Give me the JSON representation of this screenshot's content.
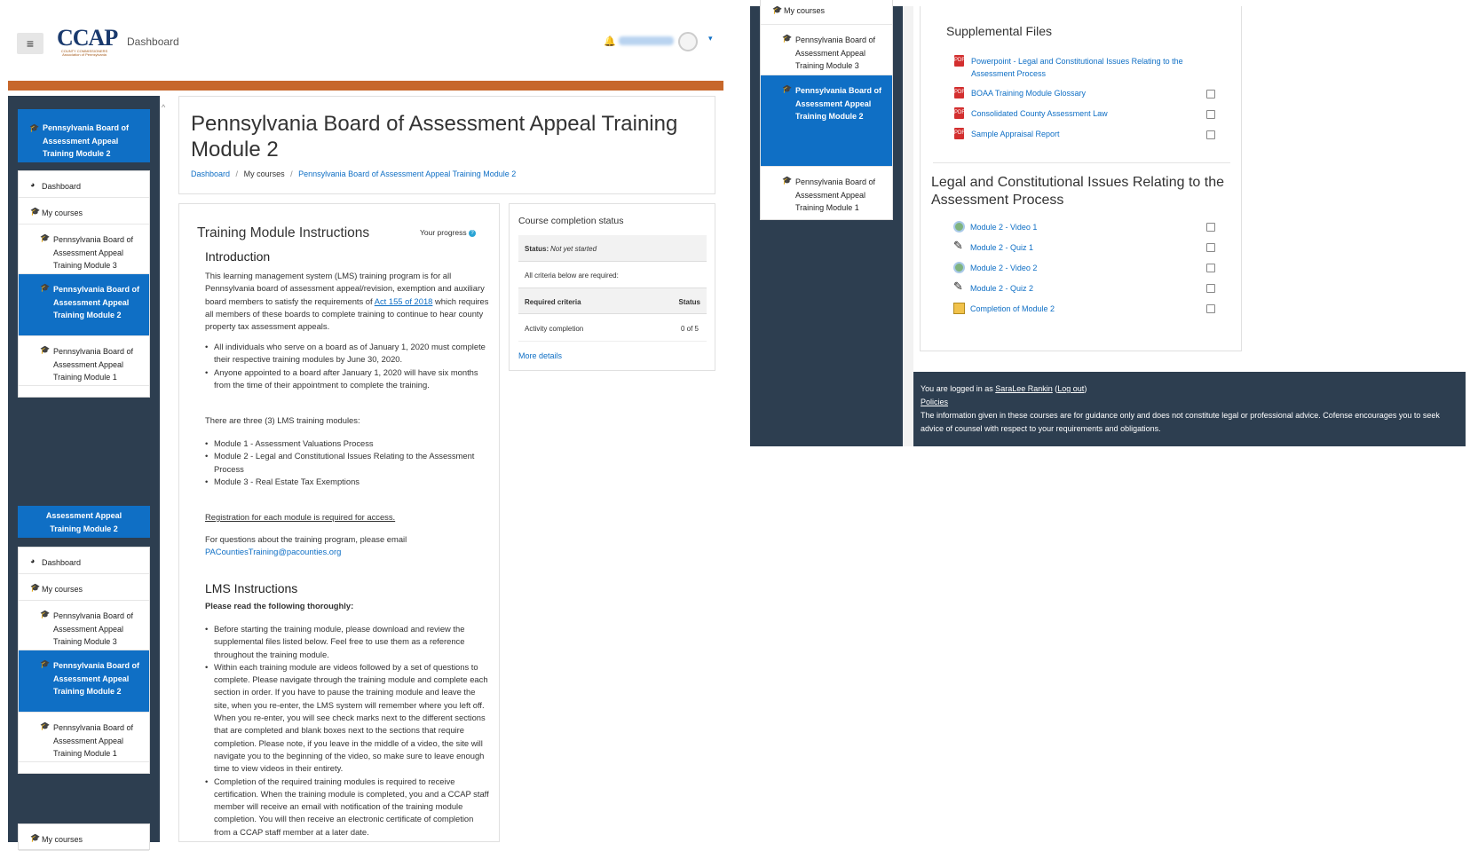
{
  "header": {
    "menu_icon": "hamburger-icon",
    "logo_text": "CCAP",
    "logo_sub": "COUNTY COMMISSIONERS Association of Pennsylvania",
    "nav_dashboard": "Dashboard",
    "bell_icon": "bell-icon",
    "caret": "▾"
  },
  "sidebar": {
    "course_title": "Pennsylvania Board of Assessment Appeal Training Module 2",
    "course_title_partial": "Assessment Appeal Training Module 2",
    "dashboard": "Dashboard",
    "my_courses": "My courses",
    "courses": [
      {
        "label": "Pennsylvania Board of Assessment Appeal Training Module 3",
        "active": false
      },
      {
        "label": "Pennsylvania Board of Assessment Appeal Training Module 2",
        "active": true
      },
      {
        "label": "Pennsylvania Board of Assessment Appeal Training Module 1",
        "active": false
      }
    ],
    "scroll_indicator": "^"
  },
  "page": {
    "title": "Pennsylvania Board of Assessment Appeal Training Module 2",
    "breadcrumb": [
      "Dashboard",
      "My courses",
      "Pennsylvania Board of Assessment Appeal Training Module 2"
    ],
    "breadcrumb_sep": "/"
  },
  "instructions": {
    "heading": "Training Module Instructions",
    "progress_label": "Your progress",
    "intro_heading": "Introduction",
    "intro_p1": "This learning management system (LMS) training program is for all Pennsylvania board of assessment appeal/revision, exemption and auxiliary board members to satisfy the requirements of ",
    "intro_link": "Act 155 of 2018",
    "intro_p1_end": " which requires all members of these boards to complete training to continue to hear county property tax assessment appeals.",
    "bullets1": [
      "All individuals who serve on a board as of January 1, 2020 must complete their respective training modules by June 30, 2020.",
      "Anyone appointed to a board after January 1, 2020 will have six months from the time of their appointment to complete the training."
    ],
    "modules_intro": "There are three (3) LMS training modules:",
    "modules": [
      "Module 1 - Assessment Valuations Process",
      "Module 2 - Legal and Constitutional Issues Relating to the Assessment Process",
      "Module 3 - Real Estate Tax Exemptions"
    ],
    "registration": "Registration for each module is required for access.",
    "questions": "For questions about the training program, please email",
    "email": "PACountiesTraining@pacounties.org",
    "lms_heading": "LMS Instructions",
    "lms_sub": "Please read the following thoroughly:",
    "lms_bullets": [
      "Before starting the training module, please download and review the supplemental files listed below. Feel free to use them as a reference throughout the training module.",
      "Within each training module are videos followed by a set of questions to complete. Please navigate through the training module and complete each section in order. If you have to pause the training module and leave the site, when you re-enter, the LMS system will remember where you left off. When you re-enter, you will see check marks next to the different sections that are completed and blank boxes next to the sections that require completion. Please note, if you leave in the middle of a video, the site will navigate you to the beginning of the video, so make sure to leave enough time to view videos in their entirety.",
      "Completion of the required training modules is required to receive certification. When the training module is completed, you and a CCAP staff member will receive an email with notification of the training module completion. You will then receive an electronic certificate of completion from a CCAP staff member at a later date."
    ]
  },
  "completion": {
    "heading": "Course completion status",
    "status_label": "Status:",
    "status_value": "Not yet started",
    "criteria_note": "All criteria below are required:",
    "col_criteria": "Required criteria",
    "col_status": "Status",
    "row_label": "Activity completion",
    "row_value": "0 of 5",
    "more": "More details"
  },
  "right": {
    "sidebar_top": "My courses",
    "courses": [
      {
        "label": "Pennsylvania Board of Assessment Appeal Training Module 3",
        "active": false
      },
      {
        "label": "Pennsylvania Board of Assessment Appeal Training Module 2",
        "active": true
      },
      {
        "label": "Pennsylvania Board of Assessment Appeal Training Module 1",
        "active": false
      }
    ],
    "supp_heading": "Supplemental Files",
    "files": [
      "Powerpoint - Legal and Constitutional Issues Relating to the Assessment Process",
      "BOAA Training Module Glossary",
      "Consolidated County Assessment Law",
      "Sample Appraisal Report"
    ],
    "section_heading": "Legal and Constitutional Issues Relating to the Assessment Process",
    "activities": [
      {
        "label": "Module 2 - Video 1",
        "icon": "video-icon"
      },
      {
        "label": "Module 2 - Quiz 1",
        "icon": "quiz-icon"
      },
      {
        "label": "Module 2 - Video 2",
        "icon": "video-icon"
      },
      {
        "label": "Module 2 - Quiz 2",
        "icon": "quiz-icon"
      },
      {
        "label": "Completion of Module 2",
        "icon": "certificate-icon"
      }
    ]
  },
  "footer": {
    "logged_prefix": "You are logged in as ",
    "user": "SaraLee Rankin",
    "logout": "Log out",
    "policies": "Policies",
    "disclaimer": "The information given in these courses are for guidance only and does not constitute legal or professional advice. Cofense encourages you to seek advice of counsel with respect to your requirements and obligations."
  },
  "colors": {
    "brand_blue": "#0f6fc5",
    "sidebar_dark": "#2d3e50",
    "header_bar": "#c7672b"
  }
}
